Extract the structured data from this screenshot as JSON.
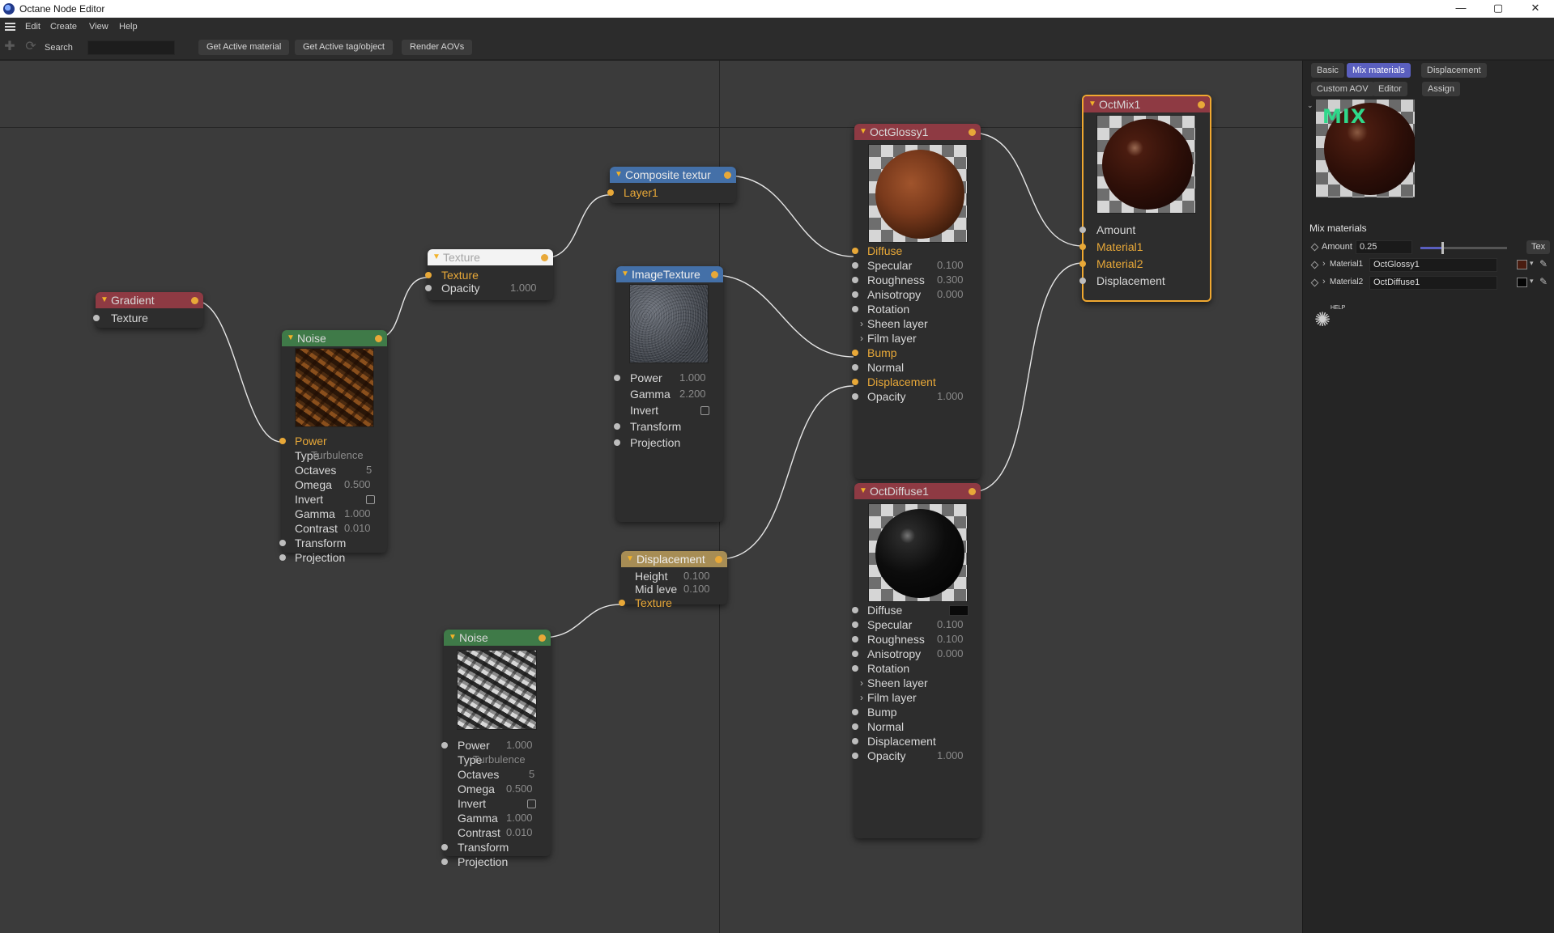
{
  "window": {
    "title": "Octane Node Editor",
    "minimize_glyph": "—",
    "maximize_glyph": "▢",
    "close_glyph": "✕"
  },
  "menu": {
    "items": [
      "Edit",
      "Create",
      "View",
      "Help"
    ]
  },
  "toolbar": {
    "search_label": "Search",
    "search_value": "",
    "buttons": [
      "Get Active material",
      "Get Active tag/object",
      "Render AOVs"
    ]
  },
  "nodes": {
    "gradient": {
      "title": "Gradient",
      "texture_label": "Texture"
    },
    "noise1": {
      "title": "Noise",
      "power_label": "Power",
      "type_label": "Type",
      "type_value": "Turbulence",
      "octaves_label": "Octaves",
      "octaves_value": "5",
      "omega_label": "Omega",
      "omega_value": "0.500",
      "invert_label": "Invert",
      "gamma_label": "Gamma",
      "gamma_value": "1.000",
      "contrast_label": "Contrast",
      "contrast_value": "0.010",
      "transform_label": "Transform",
      "projection_label": "Projection"
    },
    "texture": {
      "title": "Texture",
      "texture_label": "Texture",
      "opacity_label": "Opacity",
      "opacity_value": "1.000"
    },
    "composite": {
      "title": "Composite textur",
      "layer1_label": "Layer1"
    },
    "image_texture": {
      "title": "ImageTexture",
      "power_label": "Power",
      "power_value": "1.000",
      "gamma_label": "Gamma",
      "gamma_value": "2.200",
      "invert_label": "Invert",
      "transform_label": "Transform",
      "projection_label": "Projection"
    },
    "displacement": {
      "title": "Displacement",
      "height_label": "Height",
      "height_value": "0.100",
      "mid_label": "Mid leve",
      "mid_value": "0.100",
      "texture_label": "Texture"
    },
    "noise2": {
      "title": "Noise",
      "power_label": "Power",
      "power_value": "1.000",
      "type_label": "Type",
      "type_value": "Turbulence",
      "octaves_label": "Octaves",
      "octaves_value": "5",
      "omega_label": "Omega",
      "omega_value": "0.500",
      "invert_label": "Invert",
      "gamma_label": "Gamma",
      "gamma_value": "1.000",
      "contrast_label": "Contrast",
      "contrast_value": "0.010",
      "transform_label": "Transform",
      "projection_label": "Projection"
    },
    "glossy": {
      "title": "OctGlossy1",
      "diffuse_label": "Diffuse",
      "specular_label": "Specular",
      "specular_value": "0.100",
      "roughness_label": "Roughness",
      "roughness_value": "0.300",
      "anisotropy_label": "Anisotropy",
      "anisotropy_value": "0.000",
      "rotation_label": "Rotation",
      "sheen_label": "Sheen layer",
      "film_label": "Film layer",
      "bump_label": "Bump",
      "normal_label": "Normal",
      "displacement_label": "Displacement",
      "opacity_label": "Opacity",
      "opacity_value": "1.000"
    },
    "diffuse": {
      "title": "OctDiffuse1",
      "diffuse_label": "Diffuse",
      "specular_label": "Specular",
      "specular_value": "0.100",
      "roughness_label": "Roughness",
      "roughness_value": "0.100",
      "anisotropy_label": "Anisotropy",
      "anisotropy_value": "0.000",
      "rotation_label": "Rotation",
      "sheen_label": "Sheen layer",
      "film_label": "Film layer",
      "bump_label": "Bump",
      "normal_label": "Normal",
      "displacement_label": "Displacement",
      "opacity_label": "Opacity",
      "opacity_value": "1.000"
    },
    "mix": {
      "title": "OctMix1",
      "amount_label": "Amount",
      "material1_label": "Material1",
      "material2_label": "Material2",
      "displacement_label": "Displacement"
    }
  },
  "panel": {
    "tabs_row1": [
      "Basic",
      "Mix materials",
      "Displacement"
    ],
    "tabs_row2": [
      "Custom AOV",
      "Editor",
      "Assign"
    ],
    "active_tab": "Mix materials",
    "preview_badge": "MIX",
    "section_title": "Mix materials",
    "amount_label": "Amount",
    "amount_value": "0.25",
    "amount_fraction": 0.25,
    "tex_button": "Tex",
    "material1_label": "Material1",
    "material1_value": "OctGlossy1",
    "material2_label": "Material2",
    "material2_value": "OctDiffuse1",
    "help_label": "HELP"
  },
  "colors": {
    "accent": "#5a5fbf",
    "port_active": "#e8a838",
    "node_red": "#8e3a43",
    "node_green": "#3f7a48",
    "node_blue": "#4470a8",
    "mix_border": "#f0a830"
  }
}
